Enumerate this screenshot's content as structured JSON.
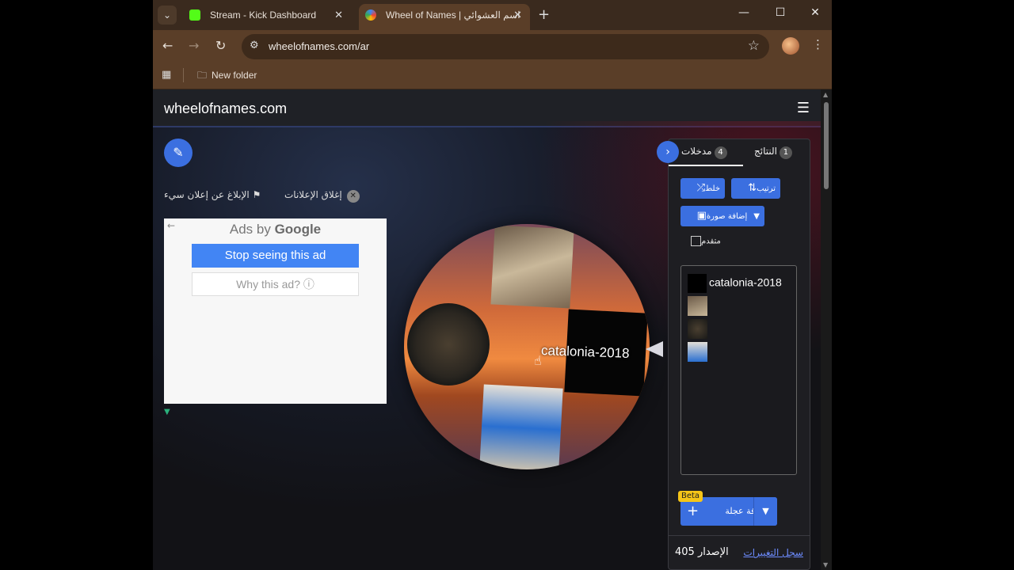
{
  "browser": {
    "tabs": [
      {
        "title": "Stream - Kick Dashboard",
        "icon": "kick-icon",
        "color": "#53fc18"
      },
      {
        "title": "Wheel of Names | اسم العشوائي",
        "icon": "wheel-icon",
        "color": "#4285f4"
      }
    ],
    "url": "wheelofnames.com/ar",
    "bookmark_folder": "New folder"
  },
  "site": {
    "title": "wheelofnames.com",
    "report_ad": "الإبلاغ عن إعلان سيء",
    "close_ads": "إغلاق الإعلانات"
  },
  "ad": {
    "title_prefix": "Ads by",
    "title_brand": "Google",
    "stop_label": "Stop seeing this ad",
    "why_label": "Why this ad? ⓘ"
  },
  "wheel": {
    "visible_label": "catalonia-2018",
    "pointer_color": "#d8d8e0"
  },
  "panel": {
    "tabs": [
      {
        "label": "مدخلات",
        "count": "4"
      },
      {
        "label": "النتائج",
        "count": "1"
      }
    ],
    "shuffle_label": "خلط",
    "sort_label": "ترتيب",
    "add_image_label": "إضافة صورة",
    "advanced_label": "متقدم",
    "entries": [
      "catalonia-2018"
    ],
    "add_wheel_label": "إضافة عجلة",
    "beta_label": "Beta",
    "version_label": "الإصدار 405",
    "changelog_label": "سجل التغييرات",
    "accent": "#3b6fe0"
  }
}
